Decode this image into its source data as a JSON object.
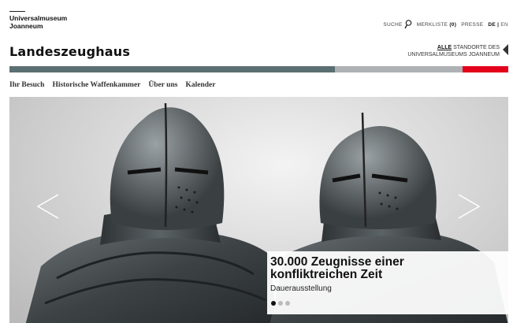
{
  "logo": {
    "line1": "Universalmuseum",
    "line2": "Joanneum"
  },
  "topnav": {
    "search_label": "SUCHE",
    "merkliste_label": "MERKLISTE",
    "merkliste_count": "(0)",
    "presse_label": "PRESSE",
    "lang_de": "DE",
    "lang_sep": "|",
    "lang_en": "EN"
  },
  "site_title": "Landeszeughaus",
  "standorte": {
    "all": "ALLE",
    "line1_rest": " STANDORTE DES",
    "line2": "UNIVERSALMUSEUMS JOANNEUM"
  },
  "colorbar": {
    "colors": [
      "#5b6f72",
      "#aeb2b4",
      "#e3001b"
    ]
  },
  "mainnav": [
    {
      "label": "Ihr Besuch"
    },
    {
      "label": "Historische Waffenkammer"
    },
    {
      "label": "Über uns"
    },
    {
      "label": "Kalender"
    }
  ],
  "slider": {
    "title_line1": "30.000 Zeugnisse einer",
    "title_line2": "konfliktreichen Zeit",
    "subtitle": "Dauerausstellung",
    "active_index": 0,
    "slide_count": 3,
    "prev_icon": "chevron-left-icon",
    "next_icon": "chevron-right-icon"
  }
}
